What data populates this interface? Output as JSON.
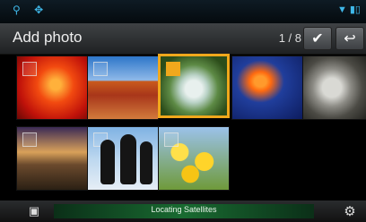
{
  "header": {
    "title": "Add photo",
    "counter": "1 / 8"
  },
  "status_bar": {
    "left_icons": [
      "usb-icon",
      "bluetooth-icon"
    ],
    "right_icons": [
      "wifi-signal-icon",
      "battery-icon"
    ]
  },
  "toolbar": {
    "confirm_icon": "checkmark-icon",
    "back_icon": "return-arrow-icon"
  },
  "photos": [
    {
      "name": "red flower",
      "selected": false
    },
    {
      "name": "desert rock",
      "selected": false
    },
    {
      "name": "white hydrangea",
      "selected": true
    },
    {
      "name": "jellyfish",
      "selected": false
    },
    {
      "name": "koala",
      "selected": false
    },
    {
      "name": "lighthouse",
      "selected": false
    },
    {
      "name": "penguins",
      "selected": false
    },
    {
      "name": "yellow tulips",
      "selected": false
    }
  ],
  "footer": {
    "status_text": "Locating Satellites",
    "left_icon": "photo-source-icon",
    "right_icon": "settings-gear-icon"
  },
  "colors": {
    "selection": "#f0a81c",
    "status_icons": "#3fb7e8",
    "gps_bar": "#196b31"
  }
}
